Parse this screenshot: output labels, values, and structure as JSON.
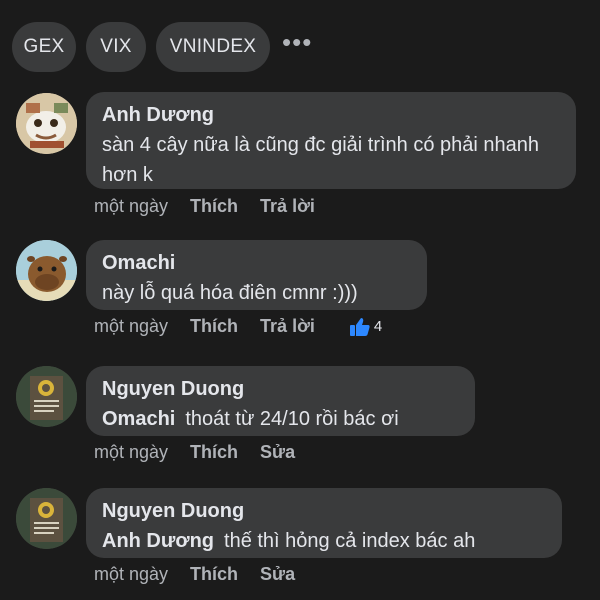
{
  "tags": [
    "GEX",
    "VIX",
    "VNINDEX"
  ],
  "more_label": "•••",
  "comments": [
    {
      "author": "Anh Dương",
      "mention": "",
      "text": "sàn 4 cây nữa là cũng đc giải trình có phải nhanh hơn k",
      "time": "một ngày",
      "like_label": "Thích",
      "second_action": "Trả lời",
      "reaction_count": ""
    },
    {
      "author": "Omachi",
      "mention": "",
      "text": "này lỗ quá hóa điên cmnr :)))",
      "time": "một ngày",
      "like_label": "Thích",
      "second_action": "Trả lời",
      "reaction_count": "4"
    },
    {
      "author": "Nguyen Duong",
      "mention": "Omachi",
      "text": "thoát từ 24/10 rồi bác ơi",
      "time": "một ngày",
      "like_label": "Thích",
      "second_action": "Sửa",
      "reaction_count": ""
    },
    {
      "author": "Nguyen Duong",
      "mention": "Anh Dương",
      "text": "thế thì hỏng cả index bác ah",
      "time": "một ngày",
      "like_label": "Thích",
      "second_action": "Sửa",
      "reaction_count": ""
    }
  ],
  "colors": {
    "background": "#1b1b1b",
    "bubble": "#3a3b3c",
    "like_blue": "#2d88ff"
  }
}
